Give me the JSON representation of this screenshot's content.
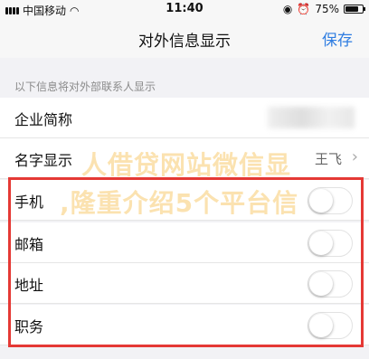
{
  "status": {
    "carrier": "中国移动",
    "time": "11:40",
    "battery": "75%"
  },
  "nav": {
    "title": "对外信息显示",
    "save_label": "保存"
  },
  "hint": "以下信息将对外部联系人显示",
  "rows": [
    {
      "label": "企业简称",
      "value": ""
    },
    {
      "label": "名字显示",
      "value": "王飞"
    },
    {
      "label": "手机",
      "enabled": false
    },
    {
      "label": "邮箱",
      "enabled": false
    },
    {
      "label": "地址",
      "enabled": false
    },
    {
      "label": "职务",
      "enabled": false
    }
  ],
  "watermark": {
    "line1": "人借贷网站微信显",
    "line2": ",隆重介绍5个平台信"
  },
  "colors": {
    "accent": "#2f7de1",
    "highlight": "#e53935",
    "watermark": "#f6be50"
  }
}
